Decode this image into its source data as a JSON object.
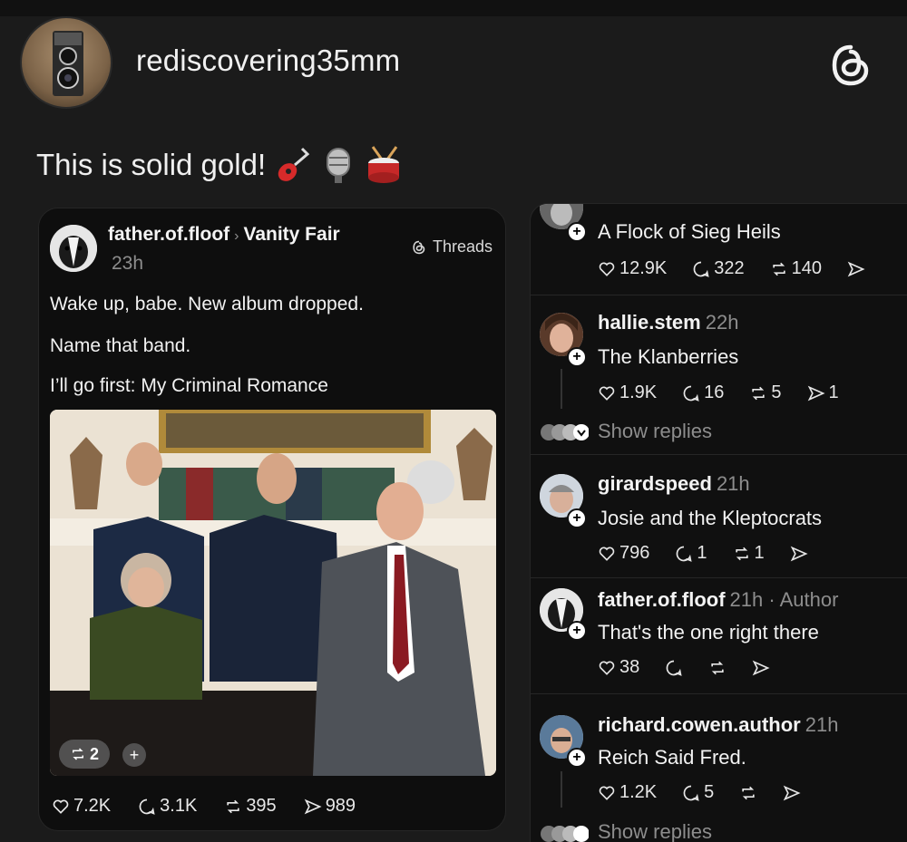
{
  "outer_post": {
    "username": "rediscovering35mm",
    "caption": "This is solid gold!",
    "caption_emojis": [
      "guitar-emoji",
      "microphone-emoji",
      "drum-emoji"
    ],
    "app_icon": "threads-logo-icon"
  },
  "card": {
    "username": "father.of.floof",
    "community": "Vanity Fair",
    "time": "23h",
    "badge": "Threads",
    "lines": [
      "Wake up, babe.  New album dropped.",
      "Name that band.",
      "I’ll go first:  My Criminal Romance"
    ],
    "photo_count": "2",
    "photo_add": "+",
    "stats": {
      "likes": "7.2K",
      "replies": "3.1K",
      "reposts": "395",
      "shares": "989"
    }
  },
  "replies": [
    {
      "username": "",
      "time": "",
      "text": "A Flock of Sieg Heils",
      "likes": "12.9K",
      "replies": "322",
      "reposts": "140",
      "shares": ""
    },
    {
      "username": "hallie.stem",
      "time": "22h",
      "text": "The Klanberries",
      "likes": "1.9K",
      "replies": "16",
      "reposts": "5",
      "shares": "1"
    },
    {
      "username": "girardspeed",
      "time": "21h",
      "text": "Josie and the Kleptocrats",
      "likes": "796",
      "replies": "1",
      "reposts": "1",
      "shares": ""
    },
    {
      "username": "father.of.floof",
      "time": "21h · Author",
      "text": "That's the one right there",
      "likes": "38",
      "replies": "",
      "reposts": "",
      "shares": ""
    },
    {
      "username": "richard.cowen.author",
      "time": "21h",
      "text": "Reich Said Fred.",
      "likes": "1.2K",
      "replies": "5",
      "reposts": "",
      "shares": ""
    }
  ],
  "show_replies": "Show replies",
  "colors": {
    "background": "#1b1b1b",
    "card": "#0e0e0e",
    "muted": "#8d8d8d",
    "text": "#f2f2f2"
  }
}
